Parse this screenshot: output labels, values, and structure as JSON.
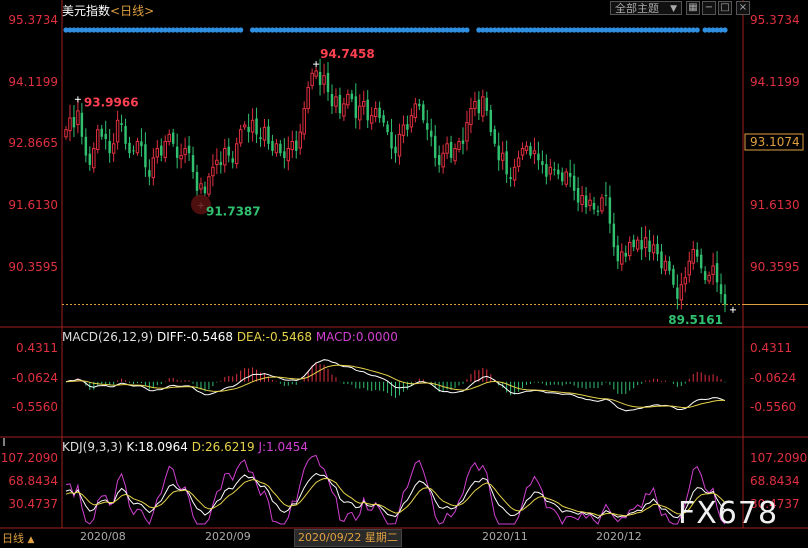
{
  "header": {
    "title": "美元指数",
    "period_tag": "<日线>",
    "theme_button": "全部主题",
    "dropdown_glyph": "▼"
  },
  "indicators": {
    "macd_label": "MACD(26,12,9)",
    "diff": "DIFF:-0.5468",
    "dea": "DEA:-0.5468",
    "macd": "MACD:0.0000",
    "kdj_label": "KDJ(9,3,3)",
    "k": "K:18.0964",
    "d": "D:26.6219",
    "j": "J:1.0454"
  },
  "watermark": "FX678",
  "date_axis": {
    "period_button": "日线",
    "selected_date": "2020/09/22 星期二",
    "ticks": [
      "2020/08",
      "2020/09",
      "2020/11",
      "2020/12"
    ]
  },
  "colors": {
    "up": "#e03040",
    "down": "#30c070",
    "dots": "#2f8fe0",
    "diff_line": "#ffffff",
    "dea_line": "#e6d24a",
    "j_line": "#d040d0"
  },
  "chart_data": [
    {
      "type": "candlestick",
      "series_name": "美元指数",
      "y_axis_left_ticks": [
        "95.3734",
        "94.1199",
        "92.8665",
        "91.6130",
        "90.3595"
      ],
      "y_axis_right_ticks": [
        "95.3734",
        "94.1199",
        "91.6130",
        "90.3595"
      ],
      "current_price_label": "93.1074",
      "ylim": [
        89.3,
        95.6
      ],
      "annotations": [
        {
          "text": "93.9966",
          "value": 93.9966,
          "candle_index": 3
        },
        {
          "text": "91.7387",
          "value": 91.7387,
          "candle_index": 34
        },
        {
          "text": "94.7458",
          "value": 94.7458,
          "candle_index": 63
        },
        {
          "text": "89.5161",
          "value": 89.5161,
          "candle_index": 168
        }
      ],
      "last_value_line": 89.63,
      "closes": [
        93.35,
        93.6,
        93.4,
        93.75,
        93.2,
        92.8,
        92.6,
        92.95,
        93.35,
        93.2,
        93.15,
        92.85,
        93.05,
        93.55,
        93.45,
        93.05,
        92.85,
        92.9,
        93.1,
        93.0,
        92.55,
        92.35,
        92.75,
        92.95,
        92.8,
        93.1,
        93.25,
        93.05,
        92.75,
        92.8,
        92.95,
        92.85,
        92.45,
        92.05,
        92.2,
        92.0,
        92.35,
        92.55,
        92.7,
        92.6,
        92.95,
        92.8,
        92.65,
        93.05,
        93.35,
        93.45,
        93.3,
        93.55,
        93.25,
        93.15,
        93.4,
        93.05,
        92.9,
        93.05,
        92.85,
        92.75,
        92.95,
        93.1,
        92.9,
        93.3,
        93.8,
        94.25,
        94.55,
        94.6,
        94.3,
        94.5,
        94.15,
        93.85,
        94.05,
        93.7,
        93.9,
        94.1,
        94.0,
        93.6,
        93.85,
        93.95,
        93.55,
        93.65,
        93.8,
        93.6,
        93.5,
        93.3,
        92.95,
        92.85,
        93.25,
        93.45,
        93.35,
        93.65,
        93.9,
        93.85,
        93.55,
        93.35,
        93.2,
        92.75,
        92.6,
        92.85,
        93.05,
        92.75,
        92.95,
        93.1,
        93.05,
        93.5,
        93.8,
        93.95,
        93.7,
        94.05,
        93.75,
        93.3,
        93.05,
        92.7,
        92.85,
        92.4,
        92.3,
        92.55,
        92.75,
        92.95,
        93.0,
        92.8,
        92.9,
        92.7,
        92.6,
        92.35,
        92.55,
        92.5,
        92.4,
        92.25,
        92.45,
        92.35,
        92.05,
        91.8,
        91.95,
        91.7,
        91.85,
        91.65,
        91.6,
        91.9,
        91.95,
        91.35,
        90.85,
        90.55,
        90.75,
        90.65,
        90.95,
        90.85,
        91.0,
        90.8,
        91.05,
        90.75,
        90.9,
        90.7,
        90.4,
        90.55,
        90.35,
        90.05,
        89.75,
        90.05,
        90.2,
        90.55,
        90.8,
        90.65,
        90.4,
        90.15,
        90.25,
        90.45,
        90.1,
        89.85,
        89.63
      ]
    },
    {
      "type": "macd",
      "y_axis_ticks": [
        "0.4311",
        "-0.0624",
        "-0.5560"
      ],
      "ylim": [
        -0.85,
        0.7
      ]
    },
    {
      "type": "kdj",
      "y_axis_ticks": [
        "107.2090",
        "68.8434",
        "30.4737"
      ],
      "ylim": [
        5,
        120
      ]
    }
  ]
}
